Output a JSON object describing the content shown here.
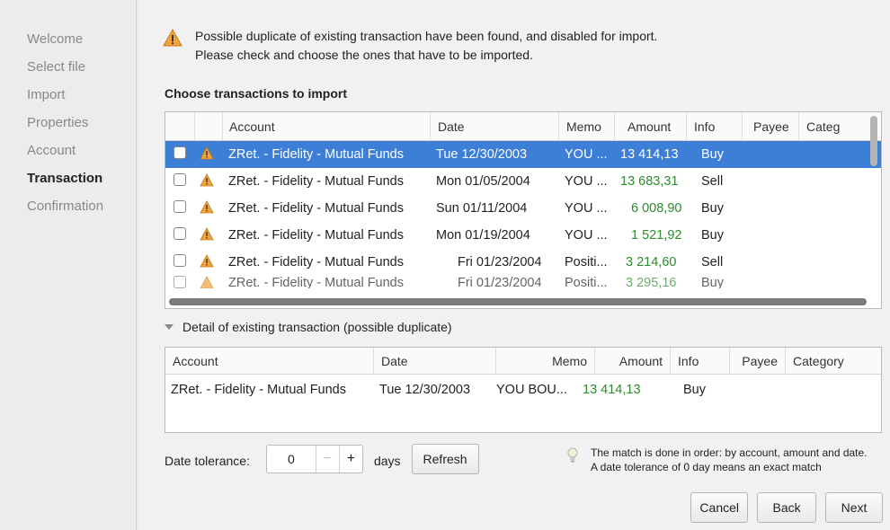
{
  "sidebar": {
    "items": [
      {
        "label": "Welcome",
        "active": false
      },
      {
        "label": "Select file",
        "active": false
      },
      {
        "label": "Import",
        "active": false
      },
      {
        "label": "Properties",
        "active": false
      },
      {
        "label": "Account",
        "active": false
      },
      {
        "label": "Transaction",
        "active": true
      },
      {
        "label": "Confirmation",
        "active": false
      }
    ]
  },
  "warning": {
    "line1": "Possible duplicate of existing transaction have been found, and disabled for import.",
    "line2": "Please check and choose the ones that have to be imported.",
    "icon": "warning-icon"
  },
  "import_section": {
    "title": "Choose transactions to import",
    "columns": [
      "",
      "",
      "Account",
      "Date",
      "Memo",
      "Amount",
      "Info",
      "Payee",
      "Categ"
    ],
    "rows": [
      {
        "account": "ZRet. - Fidelity - Mutual Funds",
        "date": "Tue 12/30/2003",
        "memo": "YOU ...",
        "amount": "13 414,13",
        "info": "Buy",
        "selected": true,
        "amount_color": "#ffffff"
      },
      {
        "account": "ZRet. - Fidelity - Mutual Funds",
        "date": "Mon 01/05/2004",
        "memo": "YOU ...",
        "amount": "13 683,31",
        "info": "Sell",
        "selected": false
      },
      {
        "account": "ZRet. - Fidelity - Mutual Funds",
        "date": "Sun 01/11/2004",
        "memo": "YOU ...",
        "amount": "6 008,90",
        "info": "Buy",
        "selected": false
      },
      {
        "account": "ZRet. - Fidelity - Mutual Funds",
        "date": "Mon 01/19/2004",
        "memo": "YOU ...",
        "amount": "1 521,92",
        "info": "Buy",
        "selected": false
      },
      {
        "account": "ZRet. - Fidelity - Mutual Funds",
        "date": "Fri 01/23/2004",
        "memo": "Positi...",
        "amount": "3 214,60",
        "info": "Sell",
        "selected": false
      },
      {
        "account": "ZRet. - Fidelity - Mutual Funds",
        "date": "Fri 01/23/2004",
        "memo": "Positi...",
        "amount": "3 295,16",
        "info": "Buy",
        "selected": false
      }
    ]
  },
  "detail": {
    "toggle_label": "Detail of existing transaction (possible duplicate)",
    "columns": [
      "Account",
      "Date",
      "Memo",
      "Amount",
      "Info",
      "Payee",
      "Category"
    ],
    "row": {
      "account": "ZRet. - Fidelity - Mutual Funds",
      "date": "Tue 12/30/2003",
      "memo": "YOU BOU...",
      "amount": "13 414,13",
      "info": "Buy"
    }
  },
  "tolerance": {
    "label": "Date tolerance:",
    "value": "0",
    "minus": "−",
    "plus": "+",
    "unit": "days",
    "refresh_label": "Refresh"
  },
  "hint": {
    "line1": "The match is done in order: by account, amount and date.",
    "line2": "A date tolerance of 0 day means an exact match"
  },
  "buttons": {
    "cancel": "Cancel",
    "back": "Back",
    "next": "Next"
  },
  "colors": {
    "selection": "#3d7fd6",
    "amount_green": "#2e8b2e",
    "warning_orange": "#f0a23b"
  }
}
